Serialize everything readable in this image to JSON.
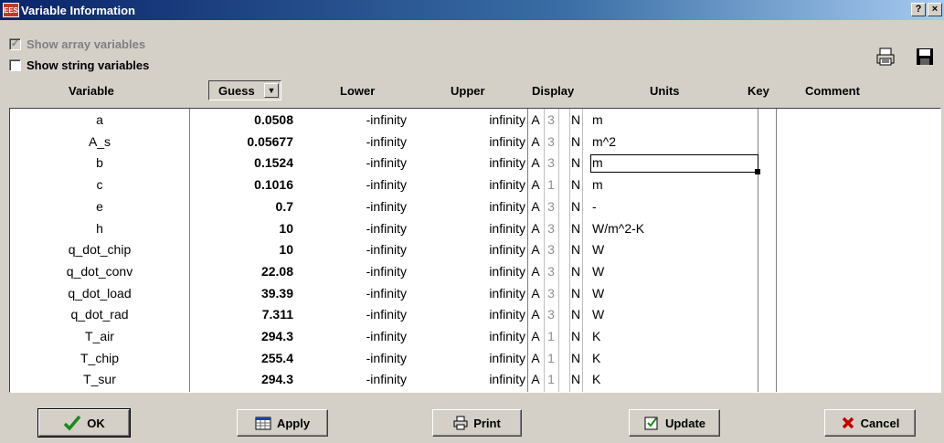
{
  "window": {
    "title": "Variable Information",
    "app_icon": "EES",
    "help": "?",
    "close": "×"
  },
  "options": {
    "show_array": {
      "label": "Show array variables",
      "checked": true,
      "disabled": true,
      "mark": "✓"
    },
    "show_string": {
      "label": "Show string variables",
      "checked": false
    }
  },
  "header": {
    "variable": "Variable",
    "guess": "Guess",
    "lower": "Lower",
    "upper": "Upper",
    "display": "Display",
    "units": "Units",
    "key": "Key",
    "comment": "Comment"
  },
  "rows": [
    {
      "name": "a",
      "guess": "0.0508",
      "lower": "-infinity",
      "upper": "infinity",
      "fmt": "A",
      "digits": "3",
      "n": "N",
      "units": "m"
    },
    {
      "name": "A_s",
      "guess": "0.05677",
      "lower": "-infinity",
      "upper": "infinity",
      "fmt": "A",
      "digits": "3",
      "n": "N",
      "units": "m^2"
    },
    {
      "name": "b",
      "guess": "0.1524",
      "lower": "-infinity",
      "upper": "infinity",
      "fmt": "A",
      "digits": "3",
      "n": "N",
      "units": "m"
    },
    {
      "name": "c",
      "guess": "0.1016",
      "lower": "-infinity",
      "upper": "infinity",
      "fmt": "A",
      "digits": "1",
      "n": "N",
      "units": "m"
    },
    {
      "name": "e",
      "guess": "0.7",
      "lower": "-infinity",
      "upper": "infinity",
      "fmt": "A",
      "digits": "3",
      "n": "N",
      "units": "-"
    },
    {
      "name": "h",
      "guess": "10",
      "lower": "-infinity",
      "upper": "infinity",
      "fmt": "A",
      "digits": "3",
      "n": "N",
      "units": "W/m^2-K"
    },
    {
      "name": "q_dot_chip",
      "guess": "10",
      "lower": "-infinity",
      "upper": "infinity",
      "fmt": "A",
      "digits": "3",
      "n": "N",
      "units": "W"
    },
    {
      "name": "q_dot_conv",
      "guess": "22.08",
      "lower": "-infinity",
      "upper": "infinity",
      "fmt": "A",
      "digits": "3",
      "n": "N",
      "units": "W"
    },
    {
      "name": "q_dot_load",
      "guess": "39.39",
      "lower": "-infinity",
      "upper": "infinity",
      "fmt": "A",
      "digits": "3",
      "n": "N",
      "units": "W"
    },
    {
      "name": "q_dot_rad",
      "guess": "7.311",
      "lower": "-infinity",
      "upper": "infinity",
      "fmt": "A",
      "digits": "3",
      "n": "N",
      "units": "W"
    },
    {
      "name": "T_air",
      "guess": "294.3",
      "lower": "-infinity",
      "upper": "infinity",
      "fmt": "A",
      "digits": "1",
      "n": "N",
      "units": "K"
    },
    {
      "name": "T_chip",
      "guess": "255.4",
      "lower": "-infinity",
      "upper": "infinity",
      "fmt": "A",
      "digits": "1",
      "n": "N",
      "units": "K"
    },
    {
      "name": "T_sur",
      "guess": "294.3",
      "lower": "-infinity",
      "upper": "infinity",
      "fmt": "A",
      "digits": "1",
      "n": "N",
      "units": "K"
    }
  ],
  "buttons": {
    "ok": "OK",
    "apply": "Apply",
    "print": "Print",
    "update": "Update",
    "cancel": "Cancel"
  },
  "icons": {
    "print_setup": "printer-icon",
    "save": "floppy-disk-icon"
  }
}
